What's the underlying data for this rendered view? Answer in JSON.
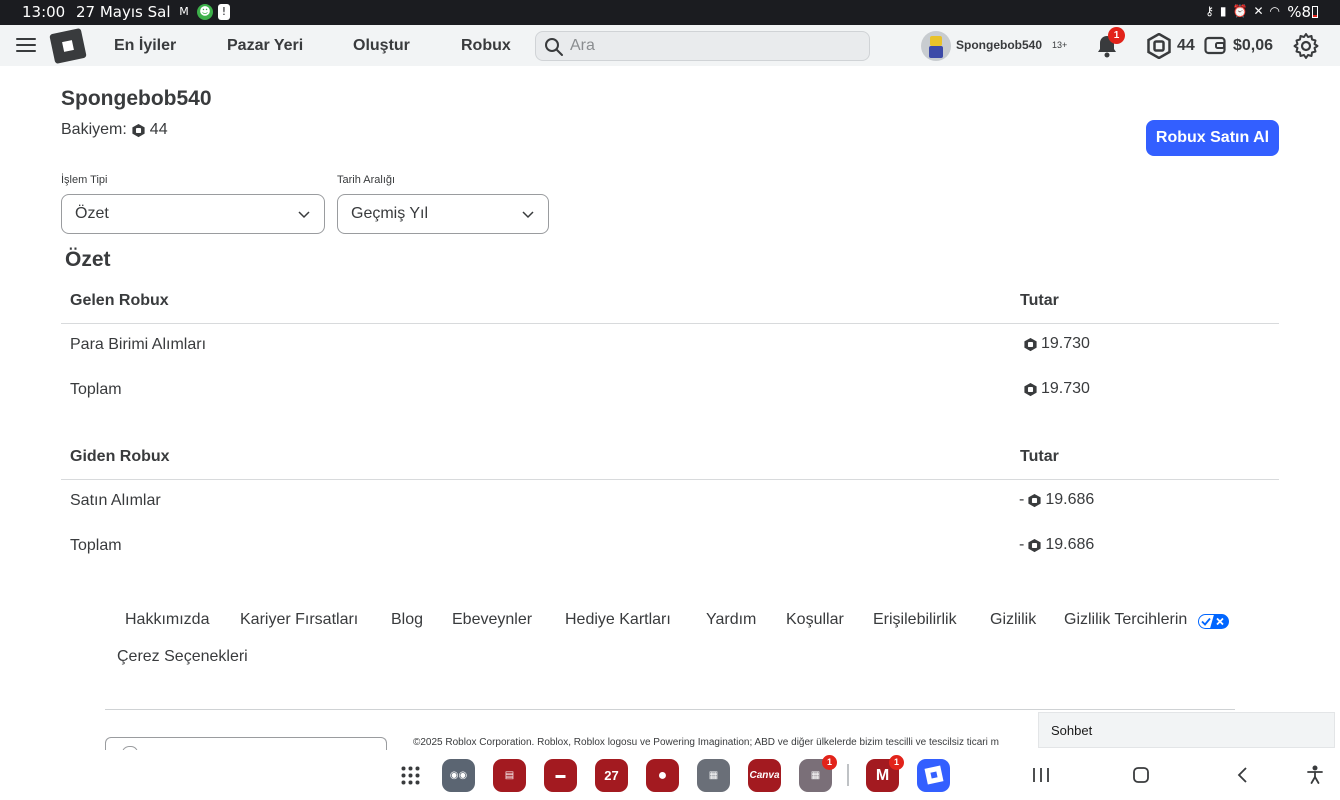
{
  "status_bar": {
    "time": "13:00",
    "date": "27 Mayıs Sal",
    "battery": "%8"
  },
  "nav": {
    "links": [
      "En İyiler",
      "Pazar Yeri",
      "Oluştur",
      "Robux"
    ],
    "search_placeholder": "Ara",
    "username": "Spongebob540",
    "age_badge": "13+",
    "notification_count": "1",
    "robux_balance": "44",
    "wallet_balance": "$0,06"
  },
  "header": {
    "username": "Spongebob540",
    "balance_label": "Bakiyem:",
    "balance_value": "44",
    "buy_button": "Robux Satın Al"
  },
  "filters": {
    "transaction_type_label": "İşlem Tipi",
    "transaction_type_value": "Özet",
    "date_range_label": "Tarih Aralığı",
    "date_range_value": "Geçmiş Yıl"
  },
  "summary": {
    "title": "Özet",
    "incoming": {
      "header": "Gelen Robux",
      "amount_header": "Tutar",
      "rows": [
        {
          "label": "Para Birimi Alımları",
          "amount": "19.730"
        },
        {
          "label": "Toplam",
          "amount": "19.730"
        }
      ]
    },
    "outgoing": {
      "header": "Giden Robux",
      "amount_header": "Tutar",
      "rows": [
        {
          "label": "Satın Alımlar",
          "sign": "-",
          "amount": "19.686"
        },
        {
          "label": "Toplam",
          "sign": "-",
          "amount": "19.686"
        }
      ]
    }
  },
  "footer": {
    "links": [
      "Hakkımızda",
      "Kariyer Fırsatları",
      "Blog",
      "Ebeveynler",
      "Hediye Kartları",
      "Yardım",
      "Koşullar",
      "Erişilebilirlik",
      "Gizlilik",
      "Gizlilik Tercihlerin",
      "Çerez Seçenekleri"
    ],
    "copyright": "©2025 Roblox Corporation. Roblox, Roblox logosu ve Powering Imagination; ABD ve diğer ülkelerde bizim tescilli ve tescilsiz ticari m"
  },
  "chat": {
    "label": "Sohbet"
  },
  "dock": {
    "calendar_day": "27",
    "canva_label": "Canva",
    "badges": [
      "1",
      "1"
    ]
  },
  "colors": {
    "accent": "#335fff",
    "text": "#393b3d",
    "nav_bg": "#f2f4f5",
    "status_bg": "#1b1c20",
    "badge_red": "#e2231a"
  }
}
